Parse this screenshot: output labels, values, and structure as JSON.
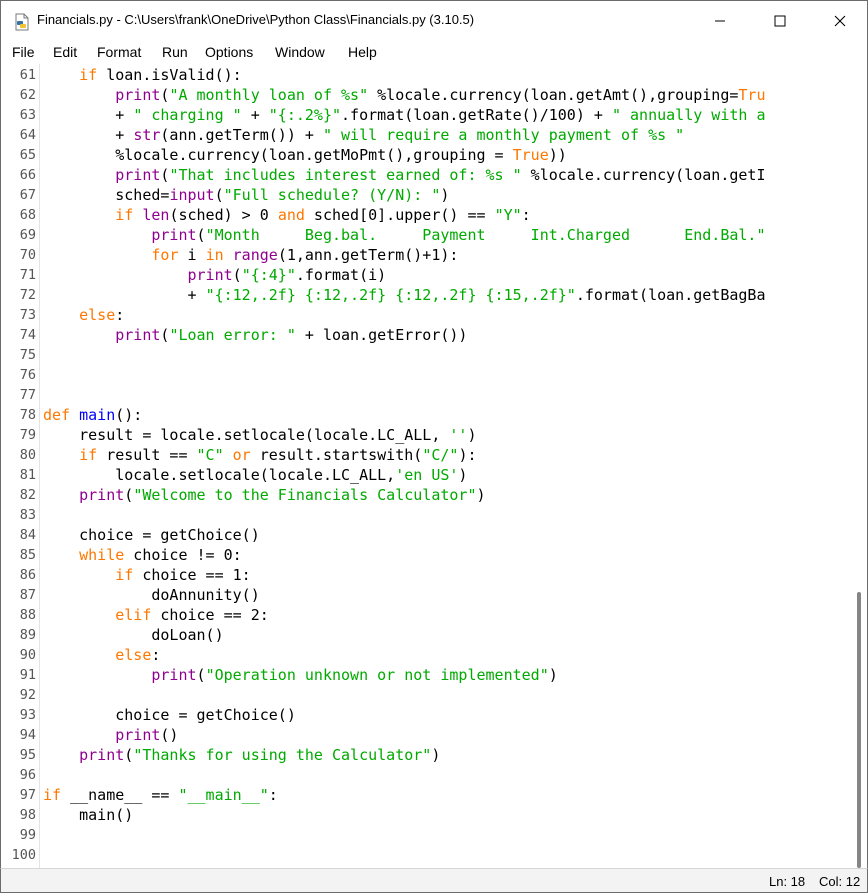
{
  "window": {
    "title": "Financials.py - C:\\Users\\frank\\OneDrive\\Python Class\\Financials.py (3.10.5)"
  },
  "icons": {
    "app": "python-file-icon",
    "minimize": "minimize-icon",
    "maximize": "maximize-icon",
    "close": "close-icon"
  },
  "menu": [
    "File",
    "Edit",
    "Format",
    "Run",
    "Options",
    "Window",
    "Help"
  ],
  "colors": {
    "keyword": "#ff7700",
    "builtin": "#900090",
    "string": "#00aa00",
    "definition": "#0000ff",
    "text": "#000000"
  },
  "status": {
    "line": "Ln: 18",
    "col": "Col: 12"
  },
  "code": [
    {
      "n": "61",
      "t": [
        {
          "c": "n",
          "s": "    "
        },
        {
          "c": "kw",
          "s": "if"
        },
        {
          "c": "n",
          "s": " loan.isValid():"
        }
      ]
    },
    {
      "n": "62",
      "t": [
        {
          "c": "n",
          "s": "        "
        },
        {
          "c": "bi",
          "s": "print"
        },
        {
          "c": "n",
          "s": "("
        },
        {
          "c": "st",
          "s": "\"A monthly loan of %s\""
        },
        {
          "c": "n",
          "s": " %locale.currency(loan.getAmt(),grouping="
        },
        {
          "c": "kw",
          "s": "Tru"
        }
      ]
    },
    {
      "n": "63",
      "t": [
        {
          "c": "n",
          "s": "        + "
        },
        {
          "c": "st",
          "s": "\" charging \""
        },
        {
          "c": "n",
          "s": " + "
        },
        {
          "c": "st",
          "s": "\"{:.2%}\""
        },
        {
          "c": "n",
          "s": ".format(loan.getRate()/100) + "
        },
        {
          "c": "st",
          "s": "\" annually with a"
        }
      ]
    },
    {
      "n": "64",
      "t": [
        {
          "c": "n",
          "s": "        + "
        },
        {
          "c": "bi",
          "s": "str"
        },
        {
          "c": "n",
          "s": "(ann.getTerm()) + "
        },
        {
          "c": "st",
          "s": "\" will require a monthly payment of %s \""
        }
      ]
    },
    {
      "n": "65",
      "t": [
        {
          "c": "n",
          "s": "        %locale.currency(loan.getMoPmt(),grouping = "
        },
        {
          "c": "kw",
          "s": "True"
        },
        {
          "c": "n",
          "s": "))"
        }
      ]
    },
    {
      "n": "66",
      "t": [
        {
          "c": "n",
          "s": "        "
        },
        {
          "c": "bi",
          "s": "print"
        },
        {
          "c": "n",
          "s": "("
        },
        {
          "c": "st",
          "s": "\"That includes interest earned of: %s \""
        },
        {
          "c": "n",
          "s": " %locale.currency(loan.getI"
        }
      ]
    },
    {
      "n": "67",
      "t": [
        {
          "c": "n",
          "s": "        sched="
        },
        {
          "c": "bi",
          "s": "input"
        },
        {
          "c": "n",
          "s": "("
        },
        {
          "c": "st",
          "s": "\"Full schedule? (Y/N): \""
        },
        {
          "c": "n",
          "s": ")"
        }
      ]
    },
    {
      "n": "68",
      "t": [
        {
          "c": "n",
          "s": "        "
        },
        {
          "c": "kw",
          "s": "if"
        },
        {
          "c": "n",
          "s": " "
        },
        {
          "c": "bi",
          "s": "len"
        },
        {
          "c": "n",
          "s": "(sched) > 0 "
        },
        {
          "c": "kw",
          "s": "and"
        },
        {
          "c": "n",
          "s": " sched[0].upper() == "
        },
        {
          "c": "st",
          "s": "\"Y\""
        },
        {
          "c": "n",
          "s": ":"
        }
      ]
    },
    {
      "n": "69",
      "t": [
        {
          "c": "n",
          "s": "            "
        },
        {
          "c": "bi",
          "s": "print"
        },
        {
          "c": "n",
          "s": "("
        },
        {
          "c": "st",
          "s": "\"Month     Beg.bal.     Payment     Int.Charged      End.Bal.\""
        }
      ]
    },
    {
      "n": "70",
      "t": [
        {
          "c": "n",
          "s": "            "
        },
        {
          "c": "kw",
          "s": "for"
        },
        {
          "c": "n",
          "s": " i "
        },
        {
          "c": "kw",
          "s": "in"
        },
        {
          "c": "n",
          "s": " "
        },
        {
          "c": "bi",
          "s": "range"
        },
        {
          "c": "n",
          "s": "(1,ann.getTerm()+1):"
        }
      ]
    },
    {
      "n": "71",
      "t": [
        {
          "c": "n",
          "s": "                "
        },
        {
          "c": "bi",
          "s": "print"
        },
        {
          "c": "n",
          "s": "("
        },
        {
          "c": "st",
          "s": "\"{:4}\""
        },
        {
          "c": "n",
          "s": ".format(i)"
        }
      ]
    },
    {
      "n": "72",
      "t": [
        {
          "c": "n",
          "s": "                + "
        },
        {
          "c": "st",
          "s": "\"{:12,.2f} {:12,.2f} {:12,.2f} {:15,.2f}\""
        },
        {
          "c": "n",
          "s": ".format(loan.getBagBa"
        }
      ]
    },
    {
      "n": "73",
      "t": [
        {
          "c": "n",
          "s": "    "
        },
        {
          "c": "kw",
          "s": "else"
        },
        {
          "c": "n",
          "s": ":"
        }
      ]
    },
    {
      "n": "74",
      "t": [
        {
          "c": "n",
          "s": "        "
        },
        {
          "c": "bi",
          "s": "print"
        },
        {
          "c": "n",
          "s": "("
        },
        {
          "c": "st",
          "s": "\"Loan error: \""
        },
        {
          "c": "n",
          "s": " + loan.getError())"
        }
      ]
    },
    {
      "n": "75",
      "t": []
    },
    {
      "n": "76",
      "t": []
    },
    {
      "n": "77",
      "t": []
    },
    {
      "n": "78",
      "t": [
        {
          "c": "kw",
          "s": "def"
        },
        {
          "c": "n",
          "s": " "
        },
        {
          "c": "df",
          "s": "main"
        },
        {
          "c": "n",
          "s": "():"
        }
      ]
    },
    {
      "n": "79",
      "t": [
        {
          "c": "n",
          "s": "    result = locale.setlocale(locale.LC_ALL, "
        },
        {
          "c": "st",
          "s": "''"
        },
        {
          "c": "n",
          "s": ")"
        }
      ]
    },
    {
      "n": "80",
      "t": [
        {
          "c": "n",
          "s": "    "
        },
        {
          "c": "kw",
          "s": "if"
        },
        {
          "c": "n",
          "s": " result == "
        },
        {
          "c": "st",
          "s": "\"C\""
        },
        {
          "c": "n",
          "s": " "
        },
        {
          "c": "kw",
          "s": "or"
        },
        {
          "c": "n",
          "s": " result.startswith("
        },
        {
          "c": "st",
          "s": "\"C/\""
        },
        {
          "c": "n",
          "s": "):"
        }
      ]
    },
    {
      "n": "81",
      "t": [
        {
          "c": "n",
          "s": "        locale.setlocale(locale.LC_ALL,"
        },
        {
          "c": "st",
          "s": "'en US'"
        },
        {
          "c": "n",
          "s": ")"
        }
      ]
    },
    {
      "n": "82",
      "t": [
        {
          "c": "n",
          "s": "    "
        },
        {
          "c": "bi",
          "s": "print"
        },
        {
          "c": "n",
          "s": "("
        },
        {
          "c": "st",
          "s": "\"Welcome to the Financials Calculator\""
        },
        {
          "c": "n",
          "s": ")"
        }
      ]
    },
    {
      "n": "83",
      "t": []
    },
    {
      "n": "84",
      "t": [
        {
          "c": "n",
          "s": "    choice = getChoice()"
        }
      ]
    },
    {
      "n": "85",
      "t": [
        {
          "c": "n",
          "s": "    "
        },
        {
          "c": "kw",
          "s": "while"
        },
        {
          "c": "n",
          "s": " choice != 0:"
        }
      ]
    },
    {
      "n": "86",
      "t": [
        {
          "c": "n",
          "s": "        "
        },
        {
          "c": "kw",
          "s": "if"
        },
        {
          "c": "n",
          "s": " choice == 1:"
        }
      ]
    },
    {
      "n": "87",
      "t": [
        {
          "c": "n",
          "s": "            doAnnunity()"
        }
      ]
    },
    {
      "n": "88",
      "t": [
        {
          "c": "n",
          "s": "        "
        },
        {
          "c": "kw",
          "s": "elif"
        },
        {
          "c": "n",
          "s": " choice == 2:"
        }
      ]
    },
    {
      "n": "89",
      "t": [
        {
          "c": "n",
          "s": "            doLoan()"
        }
      ]
    },
    {
      "n": "90",
      "t": [
        {
          "c": "n",
          "s": "        "
        },
        {
          "c": "kw",
          "s": "else"
        },
        {
          "c": "n",
          "s": ":"
        }
      ]
    },
    {
      "n": "91",
      "t": [
        {
          "c": "n",
          "s": "            "
        },
        {
          "c": "bi",
          "s": "print"
        },
        {
          "c": "n",
          "s": "("
        },
        {
          "c": "st",
          "s": "\"Operation unknown or not implemented\""
        },
        {
          "c": "n",
          "s": ")"
        }
      ]
    },
    {
      "n": "92",
      "t": []
    },
    {
      "n": "93",
      "t": [
        {
          "c": "n",
          "s": "        choice = getChoice()"
        }
      ]
    },
    {
      "n": "94",
      "t": [
        {
          "c": "n",
          "s": "        "
        },
        {
          "c": "bi",
          "s": "print"
        },
        {
          "c": "n",
          "s": "()"
        }
      ]
    },
    {
      "n": "95",
      "t": [
        {
          "c": "n",
          "s": "    "
        },
        {
          "c": "bi",
          "s": "print"
        },
        {
          "c": "n",
          "s": "("
        },
        {
          "c": "st",
          "s": "\"Thanks for using the Calculator\""
        },
        {
          "c": "n",
          "s": ")"
        }
      ]
    },
    {
      "n": "96",
      "t": []
    },
    {
      "n": "97",
      "t": [
        {
          "c": "kw",
          "s": "if"
        },
        {
          "c": "n",
          "s": " __name__ == "
        },
        {
          "c": "st",
          "s": "\"__main__\""
        },
        {
          "c": "n",
          "s": ":"
        }
      ]
    },
    {
      "n": "98",
      "t": [
        {
          "c": "n",
          "s": "    main()"
        }
      ]
    },
    {
      "n": "99",
      "t": []
    },
    {
      "n": "100",
      "t": []
    }
  ]
}
